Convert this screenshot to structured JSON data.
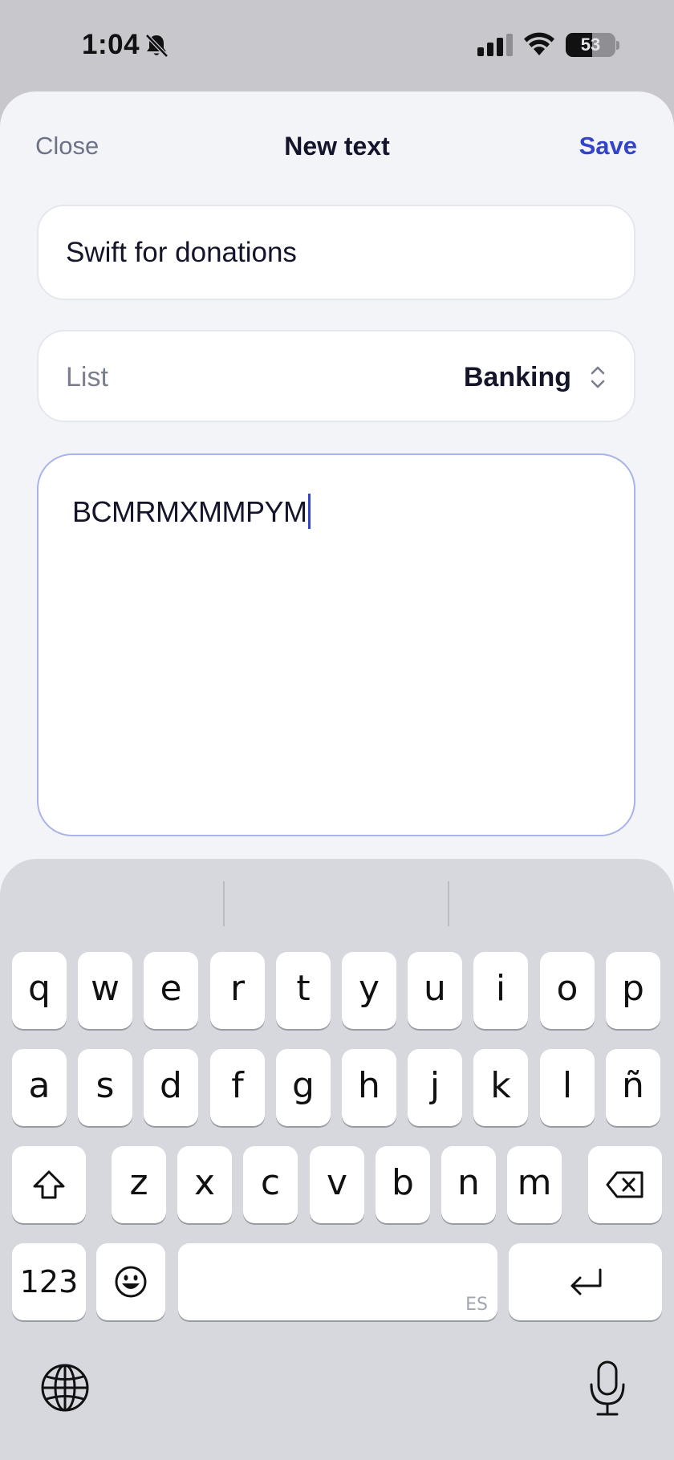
{
  "status_bar": {
    "time": "1:04",
    "battery_level": "53",
    "battery_fraction": 0.53
  },
  "nav": {
    "close_label": "Close",
    "title": "New text",
    "save_label": "Save"
  },
  "form": {
    "title_value": "Swift for donations",
    "list_label": "List",
    "list_value": "Banking",
    "content_value": "BCMRMXMMPYM"
  },
  "keyboard": {
    "row1": [
      "q",
      "w",
      "e",
      "r",
      "t",
      "y",
      "u",
      "i",
      "o",
      "p"
    ],
    "row2": [
      "a",
      "s",
      "d",
      "f",
      "g",
      "h",
      "j",
      "k",
      "l",
      "ñ"
    ],
    "row3": [
      "z",
      "x",
      "c",
      "v",
      "b",
      "n",
      "m"
    ],
    "numbers_label": "123",
    "space_language": "ES"
  },
  "colors": {
    "accent": "#3444c8",
    "sheet_background": "#f3f4f8",
    "keyboard_background": "#d6d8de"
  },
  "icons": [
    "bell-slash-icon",
    "cellular-signal-icon",
    "wifi-icon",
    "battery-icon",
    "chevron-up-down-icon",
    "shift-icon",
    "delete-icon",
    "emoji-icon",
    "return-icon",
    "globe-icon",
    "microphone-icon"
  ]
}
